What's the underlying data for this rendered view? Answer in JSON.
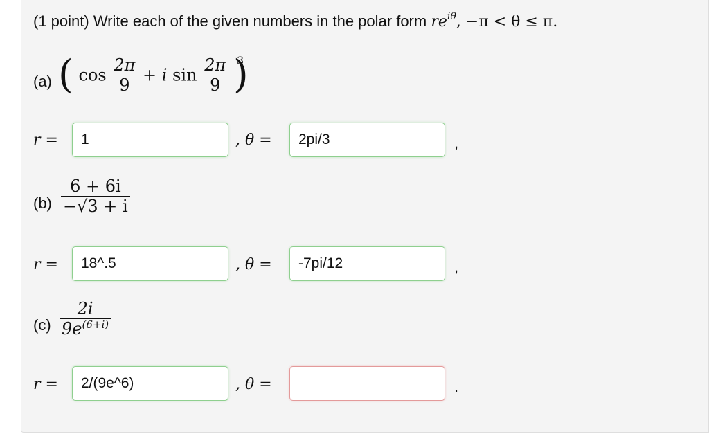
{
  "prompt": {
    "text": "(1 point) Write each of the given numbers in the polar form ",
    "r": "r",
    "e": "e",
    "exp": "iθ",
    "range": ", −π < θ ≤ π."
  },
  "part_a": {
    "label": "(a)",
    "cos": "cos",
    "plus_i": "+ i",
    "sin": "sin",
    "num1": "2π",
    "den1": "9",
    "num2": "2π",
    "den2": "9",
    "power": "3",
    "r_value": "1",
    "theta_value": "2pi/3",
    "trail": ","
  },
  "part_b": {
    "label": "(b)",
    "num": "6 + 6i",
    "den": "−√3 + i",
    "r_value": "18^.5",
    "theta_value": "-7pi/12",
    "trail": ","
  },
  "part_c": {
    "label": "(c)",
    "num": "2i",
    "den_base": "9e",
    "den_exp": "(6+i)",
    "r_value": "2/(9e^6)",
    "theta_value": "",
    "trail": "."
  },
  "labels": {
    "r_eq": "r =",
    "theta_eq": ", θ ="
  }
}
